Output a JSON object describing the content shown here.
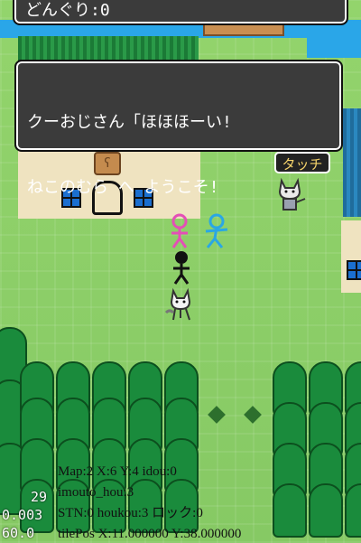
{
  "hud": {
    "acorn_counter": "どんぐり:0"
  },
  "dialog": {
    "line1": "クーおじさん「ほほほーい!",
    "line2": "ねこのむら へ ようこそ!"
  },
  "touch_button": {
    "label": "タッチ"
  },
  "debug": {
    "line1": "Map:2 X:6 Y:4 idou:0",
    "line2": "imouto_hou:3",
    "line3": "STN:0 houkou:3 ロック:0",
    "line4": "tilePos X:11.000000 Y:38.000000"
  },
  "fps": {
    "line1": "29",
    "line2": "0.003",
    "line3": "60.0"
  },
  "icons": {
    "sign": "rabbit-sign-icon",
    "cat_npc": "cat-npc-icon",
    "player": "stick-figure-icon"
  }
}
